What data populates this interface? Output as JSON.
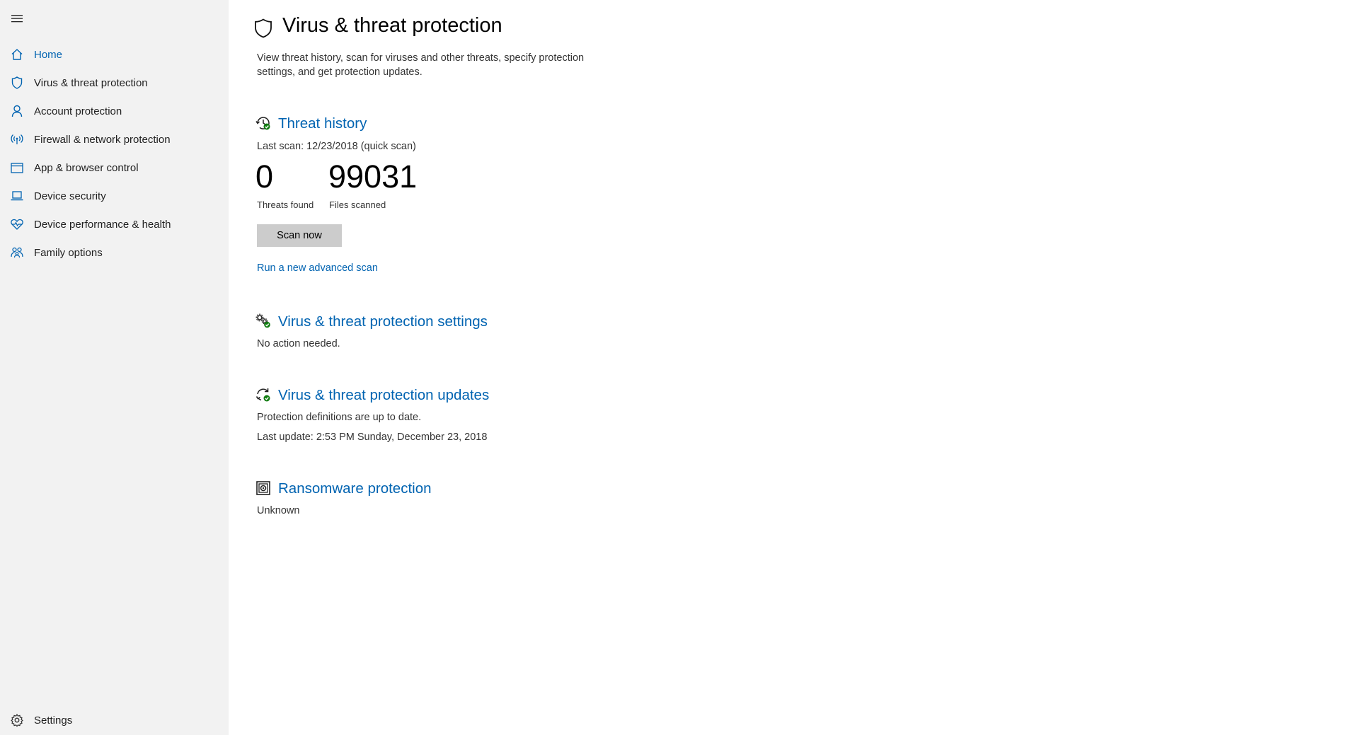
{
  "sidebar": {
    "menu_icon": "hamburger-menu-icon",
    "items": [
      {
        "label": "Home",
        "icon": "home-icon",
        "active": true
      },
      {
        "label": "Virus & threat protection",
        "icon": "shield-icon"
      },
      {
        "label": "Account protection",
        "icon": "person-icon"
      },
      {
        "label": "Firewall & network protection",
        "icon": "wifi-antenna-icon"
      },
      {
        "label": "App & browser control",
        "icon": "browser-window-icon"
      },
      {
        "label": "Device security",
        "icon": "laptop-icon"
      },
      {
        "label": "Device performance & health",
        "icon": "heart-icon"
      },
      {
        "label": "Family options",
        "icon": "family-icon"
      }
    ],
    "settings": {
      "label": "Settings",
      "icon": "gear-icon"
    }
  },
  "header": {
    "title": "Virus & threat protection",
    "icon": "shield-icon",
    "description": "View threat history, scan for viruses and other threats, specify protection settings, and get protection updates."
  },
  "threat_history": {
    "title": "Threat history",
    "icon": "clock-check-icon",
    "last_scan": "Last scan: 12/23/2018 (quick scan)",
    "threats_found_value": "0",
    "threats_found_label": "Threats found",
    "files_scanned_value": "99031",
    "files_scanned_label": "Files scanned",
    "scan_button": "Scan now",
    "advanced_link": "Run a new advanced scan"
  },
  "settings_section": {
    "title": "Virus & threat protection settings",
    "icon": "gears-check-icon",
    "status": "No action needed."
  },
  "updates_section": {
    "title": "Virus & threat protection updates",
    "icon": "refresh-check-icon",
    "status": "Protection definitions are up to date.",
    "last_update": "Last update: 2:53 PM Sunday, December 23, 2018"
  },
  "ransomware_section": {
    "title": "Ransomware protection",
    "icon": "vault-icon",
    "status": "Unknown"
  },
  "colors": {
    "accent": "#0063b1",
    "sidebar_bg": "#f2f2f2",
    "status_green": "#107c10",
    "button_bg": "#cccccc"
  }
}
